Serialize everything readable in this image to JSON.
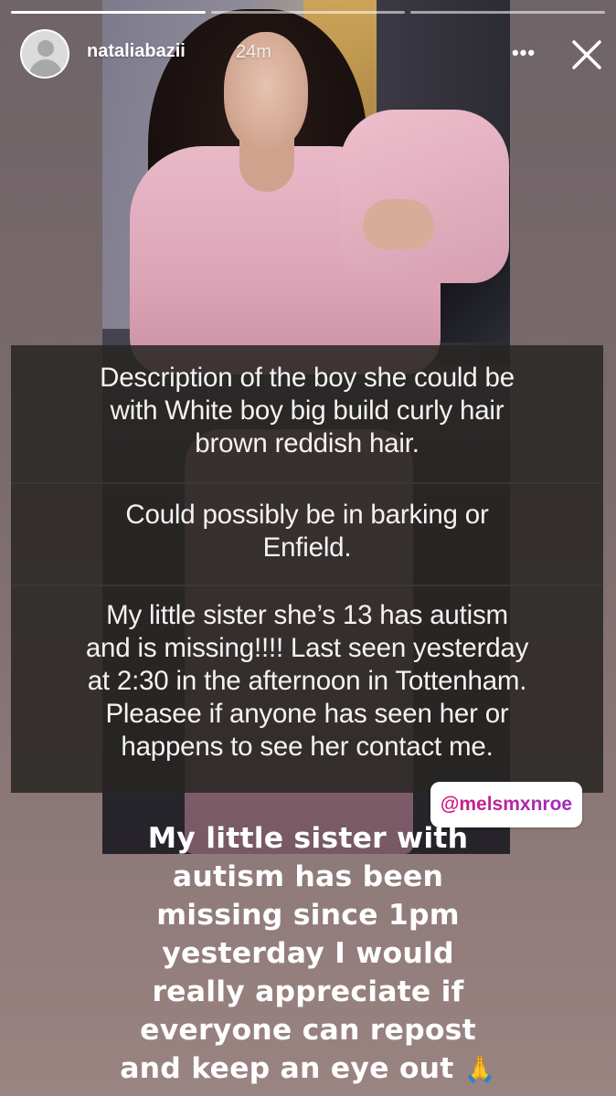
{
  "header": {
    "username": "nataliabazii",
    "time": "24m",
    "more_label": "•••",
    "progress_segments": 3,
    "active_segment": 0
  },
  "panel": {
    "paragraphs": [
      [
        "Description of the boy she could be",
        "with White boy big build curly hair",
        "brown reddish hair."
      ],
      [
        "Could possibly be in barking or",
        "Enfield."
      ],
      [
        "My little sister she’s 13 has autism",
        "and is missing!!!! Last seen yesterday",
        "at 2:30 in the afternoon in Tottenham.",
        "Pleasee if anyone has seen her or",
        "happens to see her contact me."
      ]
    ]
  },
  "mention": {
    "handle": "@melsmxnroe"
  },
  "caption": {
    "lines": [
      "My little sister with",
      "autism has been",
      "missing since 1pm",
      "yesterday I would",
      "really appreciate if",
      "everyone can repost",
      "and keep an eye out"
    ],
    "emoji": "🙏"
  },
  "icons": {
    "more": "more-horizontal-icon",
    "close": "close-icon",
    "avatar": "default-avatar-icon",
    "emoji": "folded-hands-icon"
  },
  "colors": {
    "mention_gradient_start": "#d4197e",
    "mention_gradient_end": "#9b2dbf",
    "panel_background": "#282523"
  }
}
